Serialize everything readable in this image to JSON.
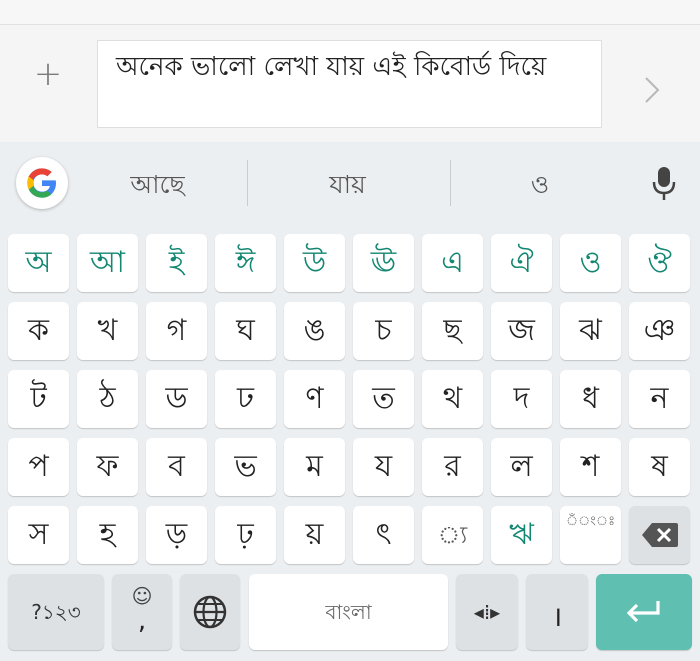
{
  "compose": {
    "text": "অনেক ভালো লেখা যায় এই কিবোর্ড দিয়ে",
    "plus_icon": "plus-icon",
    "send_icon": "chevron-right-icon"
  },
  "suggestions": [
    "আছে",
    "যায়",
    "ও"
  ],
  "rows": [
    [
      "অ",
      "আ",
      "ই",
      "ঈ",
      "উ",
      "ঊ",
      "এ",
      "ঐ",
      "ও",
      "ঔ"
    ],
    [
      "ক",
      "খ",
      "গ",
      "ঘ",
      "ঙ",
      "চ",
      "ছ",
      "জ",
      "ঝ",
      "ঞ"
    ],
    [
      "ট",
      "ঠ",
      "ড",
      "ঢ",
      "ণ",
      "ত",
      "থ",
      "দ",
      "ধ",
      "ন"
    ],
    [
      "প",
      "ফ",
      "ব",
      "ভ",
      "ম",
      "য",
      "র",
      "ল",
      "শ",
      "ষ"
    ],
    [
      "স",
      "হ",
      "ড়",
      "ঢ়",
      "য়",
      "ৎ",
      "◌্য",
      "ঋ"
    ]
  ],
  "special_key_r5": "◌ঁ◌ং◌ঃ",
  "bottom": {
    "symbols_label": "?১২৩",
    "emoji_glyph": "☺",
    "comma_glyph": ",",
    "space_label": "বাংলা",
    "cursor_glyph": "◂⁞▸",
    "danda_glyph": "।"
  },
  "colors": {
    "vowel": "#138772",
    "enter_bg": "#5fbfb0",
    "function_key_bg": "#dde1e4",
    "keyboard_bg": "#eceff1"
  }
}
